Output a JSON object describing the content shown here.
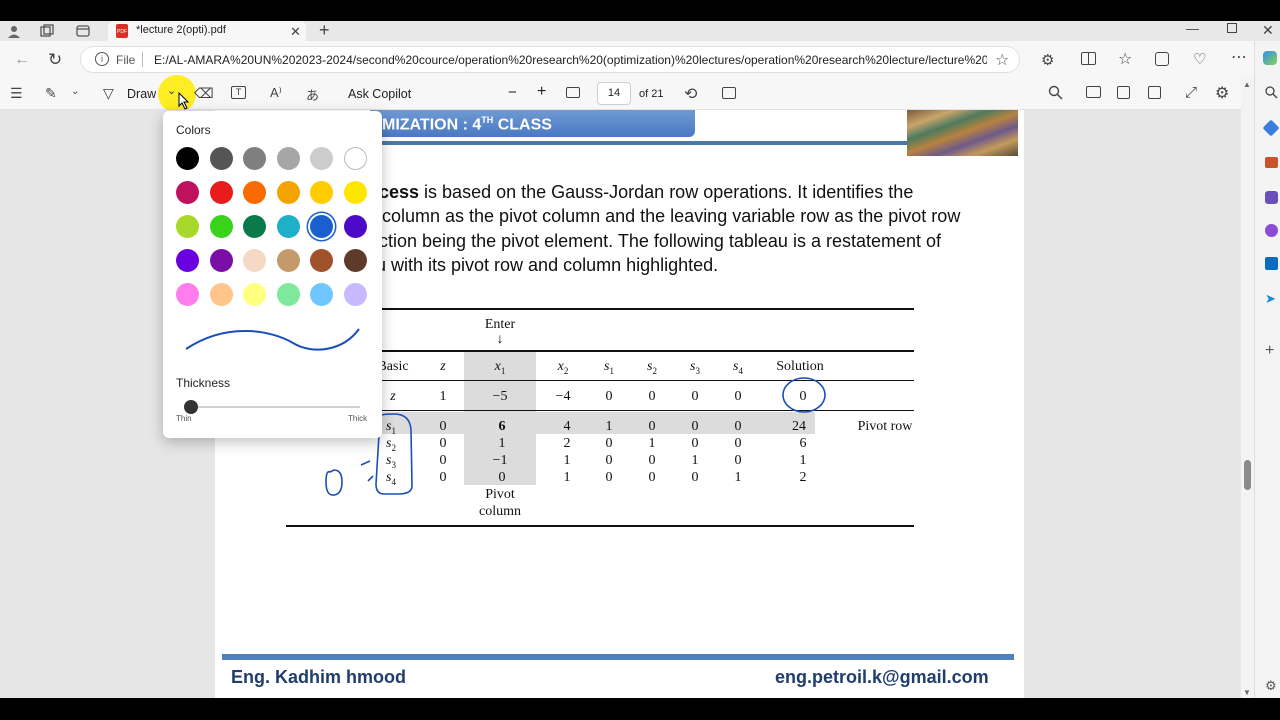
{
  "browser": {
    "tab_title": "*lecture 2(opti).pdf",
    "new_tab_symbol": "+",
    "address_scheme": "File",
    "address_url": "E:/AL-AMARA%20UN%202023-2024/second%20cource/operation%20research%20(optimization)%20lectures/operation%20research%20lecture/lecture%2020..."
  },
  "pdf_toolbar": {
    "draw_label": "Draw",
    "ask_copilot_label": "Ask Copilot",
    "zoom_out_symbol": "−",
    "zoom_in_symbol": "+",
    "current_page": "14",
    "page_total": "of 21"
  },
  "draw_popup": {
    "colors_label": "Colors",
    "thickness_label": "Thickness",
    "thin_label": "Thin",
    "thick_label": "Thick",
    "selected_color": "#1a5fd0",
    "colors": [
      [
        "#000000",
        "#555555",
        "#7f7f7f",
        "#a6a6a6",
        "#cccccc",
        "#ffffff"
      ],
      [
        "#c0125c",
        "#e81c1c",
        "#f76b00",
        "#f5a300",
        "#ffcc00",
        "#ffe600"
      ],
      [
        "#a8d82a",
        "#39d31c",
        "#0a7a4a",
        "#1fb0c9",
        "#1a5fd0",
        "#4b0ac8"
      ],
      [
        "#6a00e0",
        "#7a0fa8",
        "#f5d9c4",
        "#c49a6c",
        "#a0522d",
        "#5e3a2a"
      ],
      [
        "#ff7eeb",
        "#ffc58a",
        "#ffff80",
        "#7ee89c",
        "#6ec8ff",
        "#c8b8ff"
      ]
    ]
  },
  "slide": {
    "header_text": "MIZATION : 4",
    "header_sup": "TH",
    "header_tail": " CLASS",
    "para_line1_bold": "cess",
    "para_line1_rest": " is based on the Gauss-Jordan row operations. It identifies the",
    "para_line2": "column as the pivot column and the leaving variable row as the pivot row",
    "para_line3": "ction being the pivot element. The following tableau is a restatement of",
    "para_line4": "u with its pivot row and column highlighted.",
    "enter_label": "Enter",
    "enter_arrow": "↓",
    "headers": [
      "Basic",
      "z",
      "x1",
      "x2",
      "s1",
      "s2",
      "s3",
      "s4",
      "Solution"
    ],
    "z_row": [
      "z",
      "1",
      "−5",
      "−4",
      "0",
      "0",
      "0",
      "0",
      "0"
    ],
    "rows": [
      [
        "s1",
        "0",
        "6",
        "4",
        "1",
        "0",
        "0",
        "0",
        "24"
      ],
      [
        "s2",
        "0",
        "1",
        "2",
        "0",
        "1",
        "0",
        "0",
        "6"
      ],
      [
        "s3",
        "0",
        "−1",
        "1",
        "0",
        "0",
        "1",
        "0",
        "1"
      ],
      [
        "s4",
        "0",
        "0",
        "1",
        "0",
        "0",
        "0",
        "1",
        "2"
      ]
    ],
    "pivot_row_label": "Pivot row",
    "pivot_column_label_1": "Pivot",
    "pivot_column_label_2": "column",
    "footer_left": "Eng. Kadhim hmood",
    "footer_right": "eng.petroil.k@gmail.com"
  }
}
